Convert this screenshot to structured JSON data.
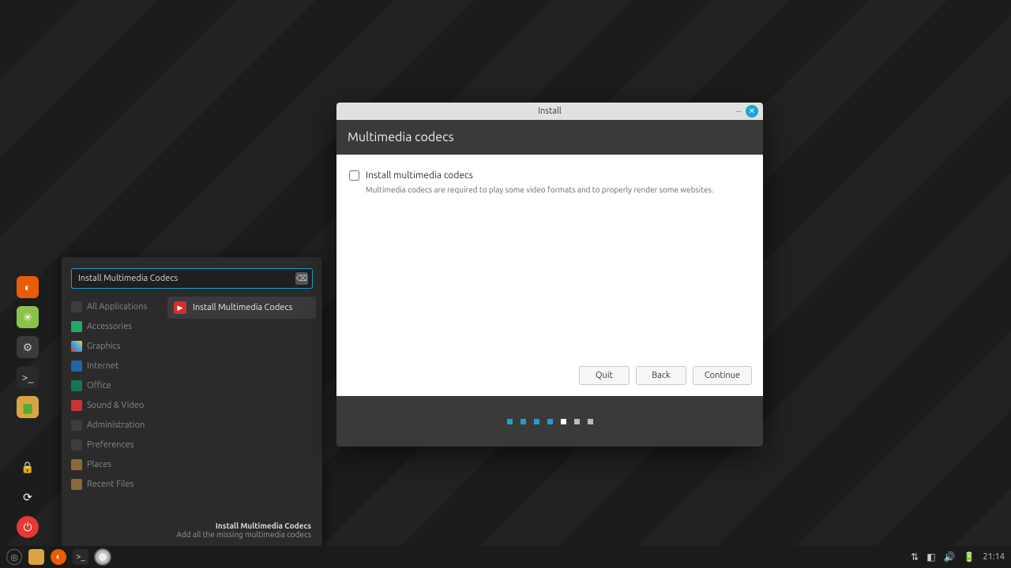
{
  "installer": {
    "window_title": "Install",
    "page_heading": "Multimedia codecs",
    "checkbox_label": "Install multimedia codecs",
    "checkbox_checked": false,
    "description": "Multimedia codecs are required to play some video formats and to properly render some websites.",
    "buttons": {
      "quit": "Quit",
      "back": "Back",
      "continue": "Continue"
    },
    "pager": {
      "total": 7,
      "current": 5,
      "states": [
        "active",
        "active",
        "active",
        "active",
        "current",
        "future",
        "future"
      ]
    }
  },
  "appmenu": {
    "search_value": "Install Multimedia Codecs",
    "categories": [
      "All Applications",
      "Accessories",
      "Graphics",
      "Internet",
      "Office",
      "Sound & Video",
      "Administration",
      "Preferences",
      "Places",
      "Recent Files"
    ],
    "results": [
      {
        "label": "Install Multimedia Codecs",
        "icon": "play"
      }
    ],
    "footer_title": "Install Multimedia Codecs",
    "footer_sub": "Add all the missing multimedia codecs"
  },
  "launcher_icons": [
    "firefox",
    "hexchat",
    "settings",
    "terminal",
    "files",
    "lock",
    "reload",
    "power"
  ],
  "taskbar": {
    "time": "21:14",
    "tray": [
      "network",
      "audio",
      "updates",
      "battery"
    ]
  }
}
